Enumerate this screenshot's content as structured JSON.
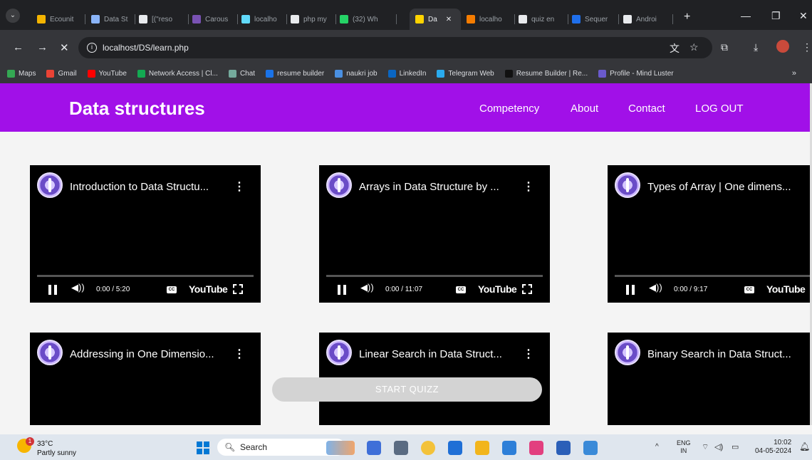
{
  "browser": {
    "tabs": [
      {
        "label": "Ecounit",
        "color": "#f4b400"
      },
      {
        "label": "Data St",
        "color": "#8ab4f8"
      },
      {
        "label": "[(\"reso",
        "color": "#e8eaed"
      },
      {
        "label": "Carous",
        "color": "#7952b3"
      },
      {
        "label": "localho",
        "color": "#61dafb"
      },
      {
        "label": "php my",
        "color": "#e8eaed"
      },
      {
        "label": "(32) Wh",
        "color": "#25d366"
      },
      {
        "label": "Da",
        "color": "#ffd400"
      },
      {
        "label": "localho",
        "color": "#f57c00"
      },
      {
        "label": "quiz en",
        "color": "#e8eaed"
      },
      {
        "label": "Sequer",
        "color": "#1f6feb"
      },
      {
        "label": "Androi",
        "color": "#e8eaed"
      }
    ],
    "url": "localhost/DS/learn.php",
    "bookmarks": [
      {
        "label": "Maps",
        "color": "#34a853"
      },
      {
        "label": "Gmail",
        "color": "#ea4335"
      },
      {
        "label": "YouTube",
        "color": "#ff0000"
      },
      {
        "label": "Network Access | Cl...",
        "color": "#13aa52"
      },
      {
        "label": "Chat",
        "color": "#74aa9c"
      },
      {
        "label": "resume builder",
        "color": "#1a73e8"
      },
      {
        "label": "naukri job",
        "color": "#4a90e2"
      },
      {
        "label": "LinkedIn",
        "color": "#0a66c2"
      },
      {
        "label": "Telegram Web",
        "color": "#2aabee"
      },
      {
        "label": "Resume Builder | Re...",
        "color": "#111111"
      },
      {
        "label": "Profile - Mind Luster",
        "color": "#6a5acd"
      }
    ],
    "bookmarks_more": "»"
  },
  "site": {
    "title": "Data structures",
    "nav": [
      "Competency",
      "About",
      "Contact",
      "LOG OUT"
    ],
    "accent": "#a110e8",
    "videos": [
      {
        "title": "Introduction to Data Structu...",
        "time": "0:00 / 5:20"
      },
      {
        "title": "Arrays in Data Structure by ...",
        "time": "0:00 / 11:07"
      },
      {
        "title": "Types of Array | One dimens...",
        "time": "0:00 / 9:17"
      },
      {
        "title": "Addressing in One Dimensio..."
      },
      {
        "title": "Linear Search in Data Struct..."
      },
      {
        "title": "Binary Search in Data Struct..."
      }
    ],
    "youtube_label": "YouTube",
    "quiz_button": "START QUIZZ"
  },
  "taskbar": {
    "weather_temp": "33°C",
    "weather_desc": "Partly sunny",
    "weather_badge": "1",
    "search_label": "Search",
    "lang_top": "ENG",
    "lang_bottom": "IN",
    "time": "10:02",
    "date": "04-05-2024"
  }
}
